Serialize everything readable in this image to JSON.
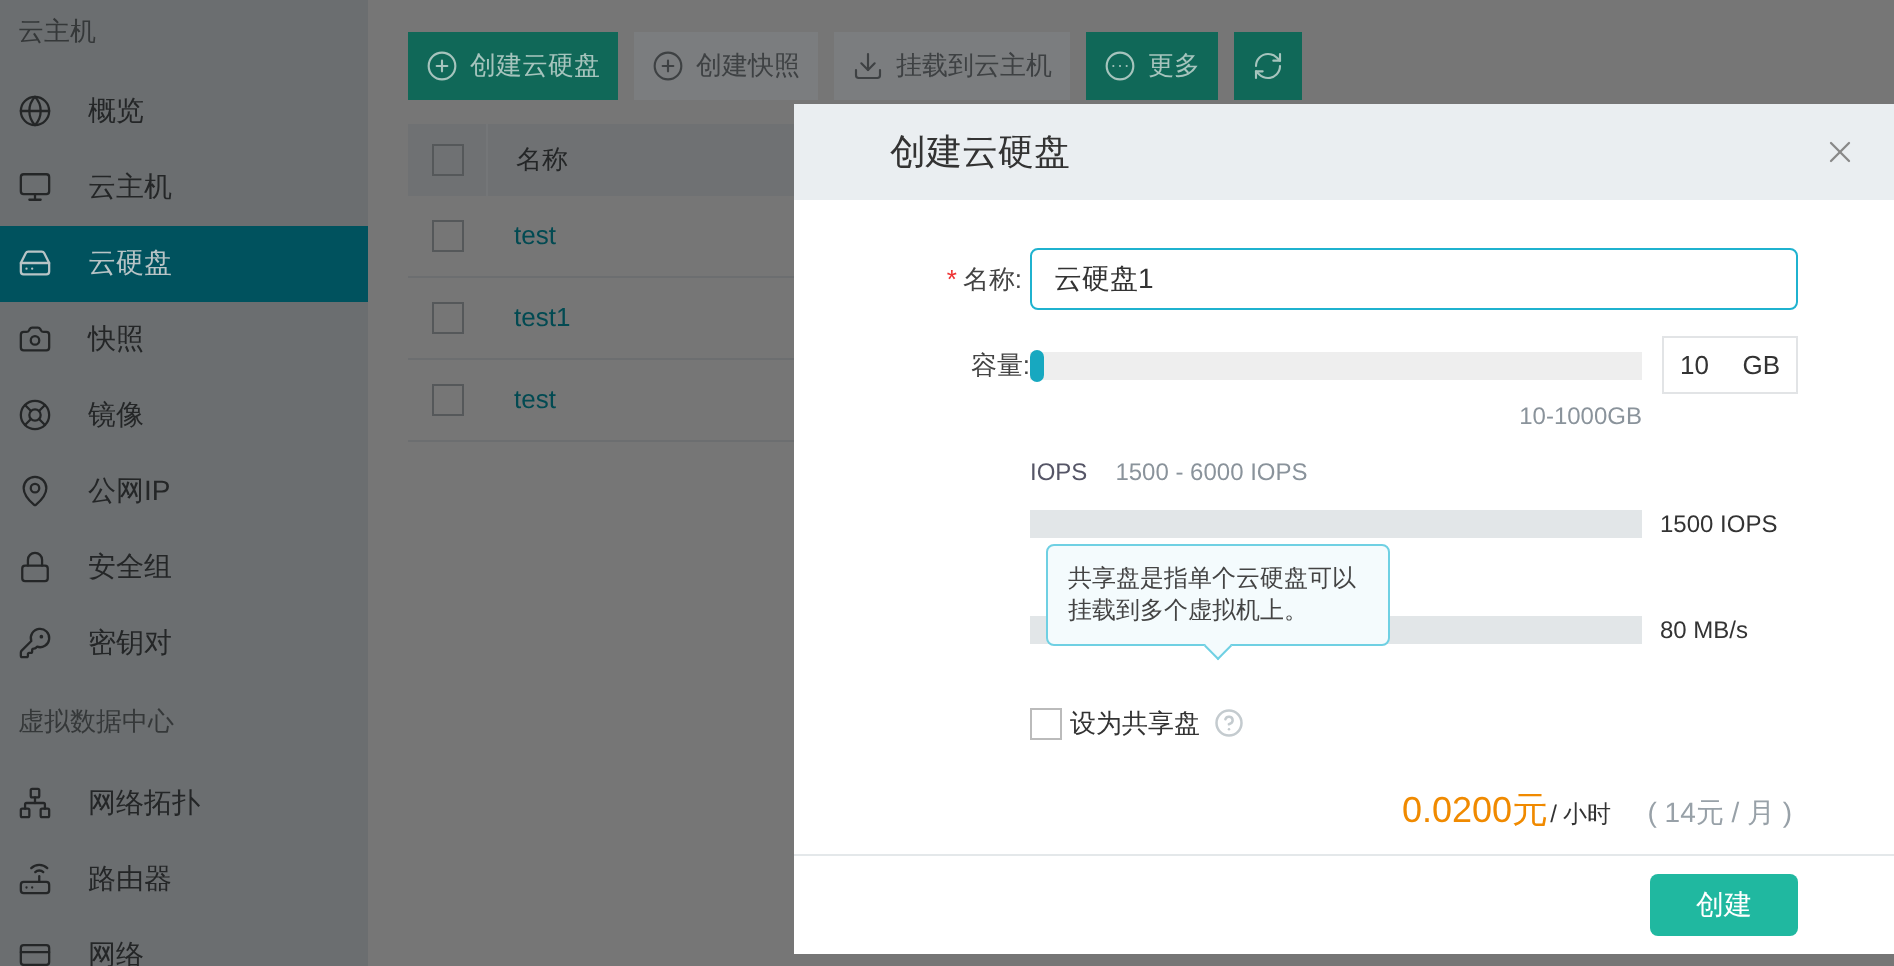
{
  "sidebar": {
    "sections": [
      {
        "title": "云主机",
        "items": [
          {
            "label": "概览",
            "selected": false
          },
          {
            "label": "云主机",
            "selected": false
          },
          {
            "label": "云硬盘",
            "selected": true
          },
          {
            "label": "快照",
            "selected": false
          },
          {
            "label": "镜像",
            "selected": false
          },
          {
            "label": "公网IP",
            "selected": false
          },
          {
            "label": "安全组",
            "selected": false
          },
          {
            "label": "密钥对",
            "selected": false
          }
        ]
      },
      {
        "title": "虚拟数据中心",
        "items": [
          {
            "label": "网络拓扑",
            "selected": false
          },
          {
            "label": "路由器",
            "selected": false
          },
          {
            "label": "网络",
            "selected": false
          }
        ]
      }
    ]
  },
  "toolbar": [
    {
      "label": "创建云硬盘",
      "disabled": false
    },
    {
      "label": "创建快照",
      "disabled": true
    },
    {
      "label": "挂载到云主机",
      "disabled": true
    },
    {
      "label": "更多",
      "disabled": false
    }
  ],
  "table": {
    "header_checked": false,
    "columns": [
      "名称"
    ],
    "rows": [
      {
        "name": "test",
        "checked": false
      },
      {
        "name": "test1",
        "checked": false
      },
      {
        "name": "test",
        "checked": false
      }
    ]
  },
  "dialog": {
    "title": "创建云硬盘",
    "required_mark": "*",
    "name_label": "名称:",
    "name_value": "云硬盘1",
    "capacity_label": "容量:",
    "capacity": {
      "level": 0,
      "value": "10",
      "unit": "GB",
      "range": "10-1000GB"
    },
    "iops": {
      "label": "IOPS",
      "range": "1500 - 6000 IOPS",
      "reading": "1500 IOPS"
    },
    "throughput": {
      "reading": "80 MB/s"
    },
    "tooltip": "共享盘是指单个云硬盘可以挂载到多个虚拟机上。",
    "shared": {
      "label": "设为共享盘",
      "checked": false
    },
    "price": {
      "hourly": "0.0200元",
      "hourly_unit": "/ 小时",
      "monthly": "( 14元 / 月 )"
    },
    "submit": "创建"
  }
}
